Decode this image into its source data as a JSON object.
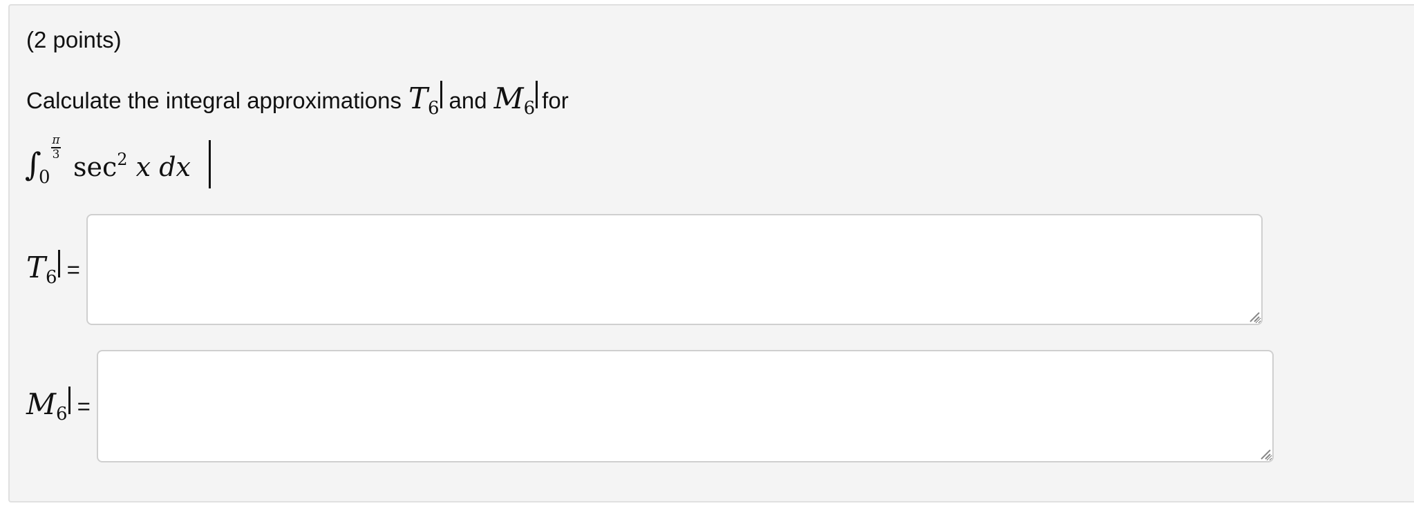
{
  "question": {
    "points": "(2 points)",
    "prompt_prefix": "Calculate the integral approximations",
    "prompt_and": "and",
    "prompt_suffix": "for",
    "t_symbol": "T",
    "m_symbol": "M",
    "subscript": "6",
    "integral": {
      "sign": "∫",
      "lower": "0",
      "upper_num": "π",
      "upper_den": "3",
      "func": "sec",
      "power": "2",
      "var": "x",
      "differential": "dx"
    }
  },
  "answers": {
    "equals": "=",
    "t6_value": "",
    "m6_value": ""
  }
}
